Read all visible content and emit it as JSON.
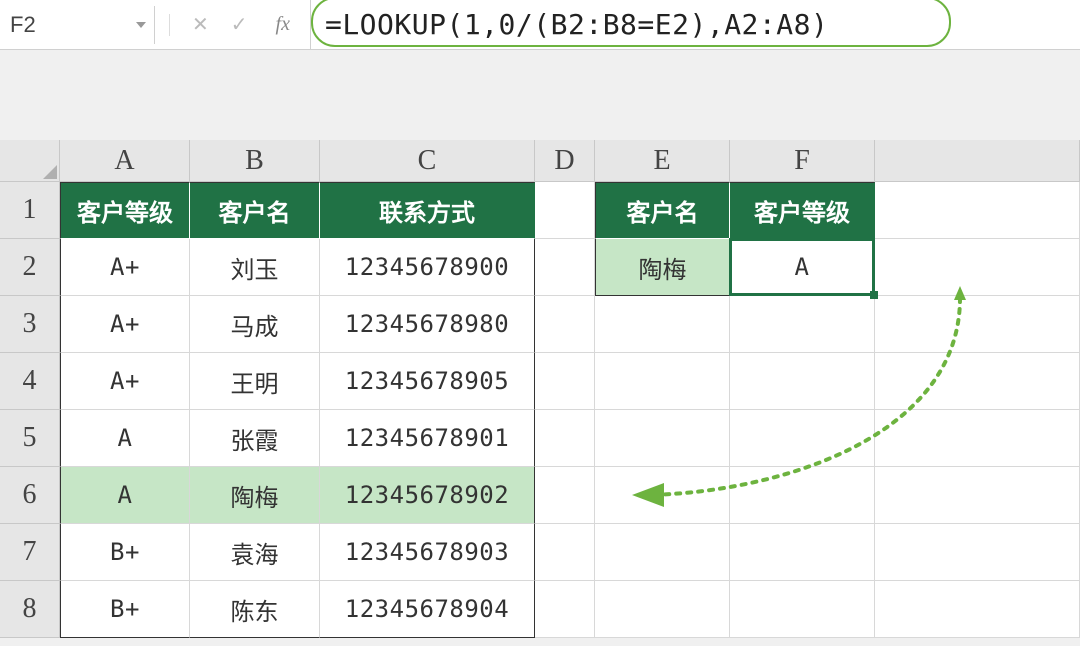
{
  "name_box": {
    "value": "F2"
  },
  "formula_bar": {
    "cancel_icon": "✕",
    "confirm_icon": "✓",
    "fx_label": "fx",
    "formula": "=LOOKUP(1,0/(B2:B8=E2),A2:A8)"
  },
  "columns": [
    "A",
    "B",
    "C",
    "D",
    "E",
    "F"
  ],
  "rows": [
    "1",
    "2",
    "3",
    "4",
    "5",
    "6",
    "7",
    "8"
  ],
  "table_main": {
    "headers": {
      "a": "客户等级",
      "b": "客户名",
      "c": "联系方式"
    },
    "rows": [
      {
        "a": "A+",
        "b": "刘玉",
        "c": "12345678900"
      },
      {
        "a": "A+",
        "b": "马成",
        "c": "12345678980"
      },
      {
        "a": "A+",
        "b": "王明",
        "c": "12345678905"
      },
      {
        "a": "A",
        "b": "张霞",
        "c": "12345678901"
      },
      {
        "a": "A",
        "b": "陶梅",
        "c": "12345678902"
      },
      {
        "a": "B+",
        "b": "袁海",
        "c": "12345678903"
      },
      {
        "a": "B+",
        "b": "陈东",
        "c": "12345678904"
      }
    ],
    "highlight_row_index": 4
  },
  "table_lookup": {
    "headers": {
      "e": "客户名",
      "f": "客户等级"
    },
    "row": {
      "e": "陶梅",
      "f": "A"
    }
  },
  "colors": {
    "header_green": "#207245",
    "highlight_green": "#c6e6c6",
    "outline_green": "#6db33f",
    "arrow_green": "#6db33f"
  }
}
